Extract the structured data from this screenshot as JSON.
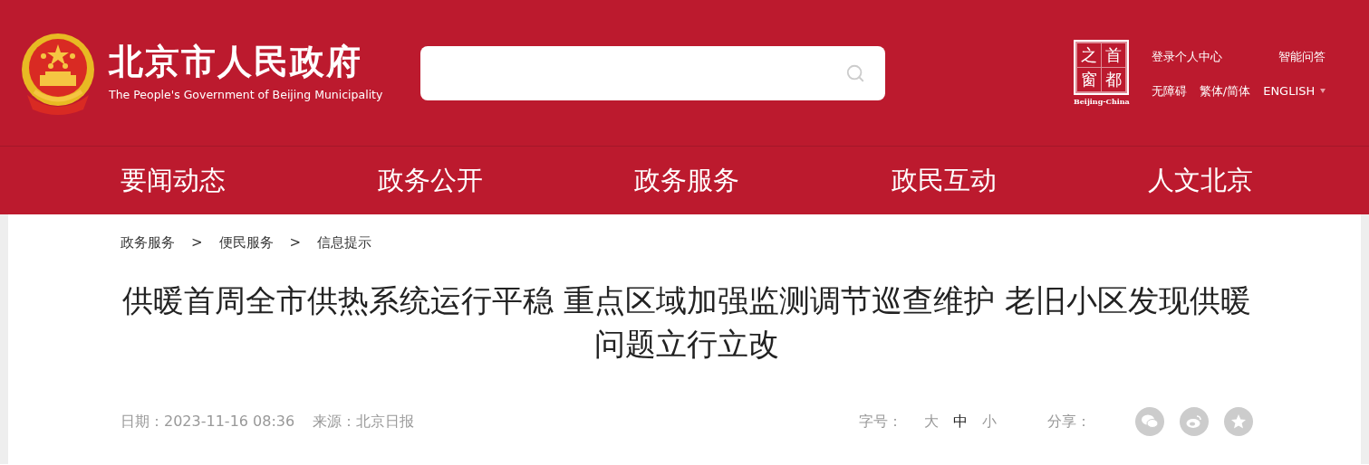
{
  "site": {
    "title": "北京市人民政府",
    "subtitle": "The People's Government of Beijing Municipality"
  },
  "badge": {
    "cells": [
      "之",
      "首",
      "窗",
      "都"
    ],
    "caption": "Beijing-China"
  },
  "top_links": [
    {
      "label": "登录个人中心"
    },
    {
      "label": "智能问答"
    },
    {
      "label": "无障碍"
    },
    {
      "label": "繁体/简体"
    },
    {
      "label": "ENGLISH",
      "dropdown": true
    }
  ],
  "nav": [
    {
      "label": "要闻动态"
    },
    {
      "label": "政务公开"
    },
    {
      "label": "政务服务"
    },
    {
      "label": "政民互动"
    },
    {
      "label": "人文北京"
    }
  ],
  "breadcrumb": [
    {
      "label": "政务服务"
    },
    {
      "label": "便民服务"
    },
    {
      "label": "信息提示"
    }
  ],
  "breadcrumb_separator": ">",
  "article": {
    "title": "供暖首周全市供热系统运行平稳 重点区域加强监测调节巡查维护 老旧小区发现供暖问题立行立改",
    "date_label": "日期：",
    "date": "2023-11-16 08:36",
    "source_label": "来源：",
    "source": "北京日报"
  },
  "font_size": {
    "label": "字号：",
    "options": [
      {
        "label": "大",
        "selected": false
      },
      {
        "label": "中",
        "selected": true
      },
      {
        "label": "小",
        "selected": false
      }
    ]
  },
  "share": {
    "label": "分享：",
    "targets": [
      {
        "kind": "wechat"
      },
      {
        "kind": "weibo"
      },
      {
        "kind": "star"
      }
    ]
  }
}
